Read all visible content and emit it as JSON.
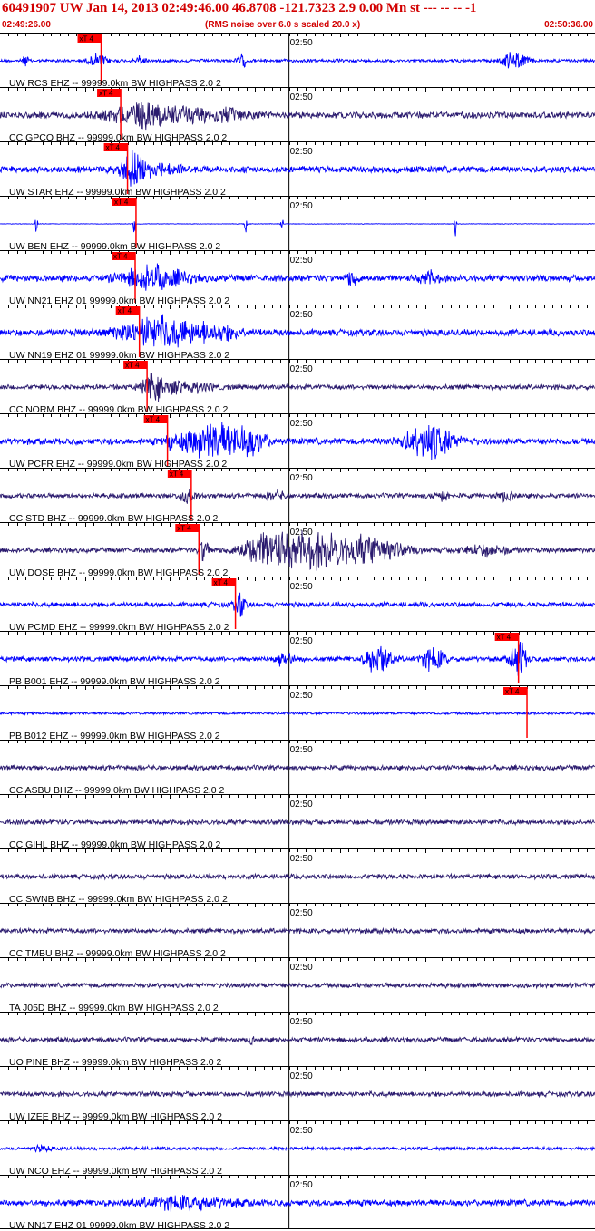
{
  "header": {
    "title": "60491907 UW Jan 14, 2013 02:49:46.00   46.8708 -121.7323  2.9 0.00 Mn st --- -- --  -1",
    "start_time": "02:49:26.00",
    "note": "(RMS noise over 6.0 s scaled 20.0 x)",
    "end_time": "02:50:36.00"
  },
  "colors": {
    "header_red": "#d20000",
    "trace_blue": "#0000ff",
    "trace_navy": "#2a1a6e",
    "pick_red": "#ff0000",
    "grid_black": "#000000"
  },
  "chart_data": {
    "type": "line",
    "chart": "seismogram record section",
    "x_start": "02:49:26.00",
    "x_end": "02:50:36.00",
    "time_marker_label": "02:50",
    "time_marker_seconds": 34,
    "total_seconds": 70,
    "pick_label": "xT 4",
    "traces": [
      {
        "label": "UW RCS EHZ -- 99999.0km BW  HIGHPASS  2.0  2",
        "color": "blue",
        "pick_s": 11.9,
        "amp": 2,
        "bursts": [
          [
            3.0,
            0.5,
            6
          ],
          [
            11.6,
            1.5,
            8
          ],
          [
            16.5,
            0.8,
            6
          ],
          [
            28.5,
            0.8,
            7
          ],
          [
            60.5,
            2.0,
            10
          ]
        ]
      },
      {
        "label": "CC GPCO BHZ -- 99999.0km BW  HIGHPASS  2.0  2",
        "color": "navy",
        "pick_s": 14.2,
        "amp": 4,
        "bursts": [
          [
            17.5,
            6.0,
            14
          ],
          [
            25.0,
            6.0,
            7
          ]
        ]
      },
      {
        "label": "UW STAR EHZ -- 99999.0km BW  HIGHPASS  2.0  2",
        "color": "blue",
        "pick_s": 15.0,
        "amp": 4,
        "bursts": [
          [
            15.3,
            1.5,
            20
          ],
          [
            18.0,
            4.0,
            8
          ]
        ]
      },
      {
        "label": "UW BEN EHZ -- 99999.0km BW  HIGHPASS  2.0  2",
        "color": "blue",
        "pick_s": 16.0,
        "amp": 0.4,
        "bursts": [
          [
            4.3,
            0.2,
            12
          ],
          [
            15.8,
            0.2,
            14
          ],
          [
            28.9,
            0.2,
            12
          ],
          [
            33.2,
            0.2,
            12
          ],
          [
            53.6,
            0.2,
            14
          ]
        ]
      },
      {
        "label": "UW NN21 EHZ 01 99999.0km BW  HIGHPASS  2.0  2",
        "color": "blue",
        "pick_s": 15.9,
        "amp": 4,
        "bursts": [
          [
            18.0,
            5.0,
            14
          ],
          [
            41.5,
            1.0,
            10
          ],
          [
            50.5,
            1.5,
            7
          ]
        ]
      },
      {
        "label": "UW NN19 EHZ 01 99999.0km BW  HIGHPASS  2.0  2",
        "color": "blue",
        "pick_s": 16.4,
        "amp": 4,
        "bursts": [
          [
            18.5,
            6.0,
            18
          ],
          [
            25.0,
            5.0,
            8
          ]
        ]
      },
      {
        "label": "CC NORM BHZ -- 99999.0km BW  HIGHPASS  2.0  2",
        "color": "navy",
        "pick_s": 17.3,
        "amp": 3,
        "bursts": [
          [
            18.0,
            1.5,
            13
          ],
          [
            21.0,
            5.0,
            7
          ]
        ]
      },
      {
        "label": "UW PCFR EHZ -- 99999.0km BW  HIGHPASS  2.0  2",
        "color": "blue",
        "pick_s": 19.7,
        "amp": 4,
        "bursts": [
          [
            20.0,
            0.5,
            12
          ],
          [
            25.0,
            5.0,
            22
          ],
          [
            29.5,
            2.5,
            12
          ],
          [
            50.5,
            4.0,
            20
          ]
        ]
      },
      {
        "label": "CC STD BHZ -- 99999.0km BW  HIGHPASS  2.0  2",
        "color": "navy",
        "pick_s": 22.5,
        "amp": 3,
        "bursts": [
          [
            22.0,
            1.5,
            7
          ],
          [
            32.5,
            1.5,
            5
          ],
          [
            52.0,
            1.5,
            5
          ],
          [
            59.5,
            1.5,
            5
          ]
        ]
      },
      {
        "label": "UW DOSE BHZ -- 99999.0km BW  HIGHPASS  2.0  2",
        "color": "navy",
        "pick_s": 23.4,
        "amp": 3,
        "bursts": [
          [
            24.0,
            0.8,
            15
          ],
          [
            31.0,
            4.0,
            18
          ],
          [
            37.0,
            6.0,
            22
          ],
          [
            44.0,
            5.0,
            15
          ],
          [
            57.0,
            4.0,
            6
          ]
        ]
      },
      {
        "label": "UW PCMD EHZ -- 99999.0km BW  HIGHPASS  2.0  2",
        "color": "blue",
        "pick_s": 27.7,
        "amp": 3,
        "bursts": [
          [
            28.2,
            0.8,
            15
          ]
        ]
      },
      {
        "label": "PB B001 EHZ -- 99999.0km BW  HIGHPASS  2.0  2",
        "color": "blue",
        "pick_s": 61.0,
        "amp": 3,
        "bursts": [
          [
            33.5,
            1.5,
            9
          ],
          [
            44.5,
            2.0,
            20
          ],
          [
            51.0,
            2.0,
            13
          ],
          [
            61.0,
            1.2,
            24
          ]
        ]
      },
      {
        "label": "PB B012 EHZ -- 99999.0km BW  HIGHPASS  2.0  2",
        "color": "blue",
        "pick_s": 62.0,
        "amp": 1.5,
        "bursts": []
      },
      {
        "label": "CC ASBU BHZ -- 99999.0km BW  HIGHPASS  2.0  2",
        "color": "navy",
        "pick_s": null,
        "amp": 3,
        "bursts": []
      },
      {
        "label": "CC GIHL BHZ -- 99999.0km BW  HIGHPASS  2.0  2",
        "color": "navy",
        "pick_s": null,
        "amp": 3,
        "bursts": []
      },
      {
        "label": "CC SWNB BHZ -- 99999.0km BW  HIGHPASS  2.0  2",
        "color": "navy",
        "pick_s": null,
        "amp": 3,
        "bursts": []
      },
      {
        "label": "CC TMBU BHZ -- 99999.0km BW  HIGHPASS  2.0  2",
        "color": "navy",
        "pick_s": null,
        "amp": 3,
        "bursts": []
      },
      {
        "label": "TA J05D BHZ -- 99999.0km BW  HIGHPASS  2.0  2",
        "color": "navy",
        "pick_s": null,
        "amp": 3,
        "bursts": []
      },
      {
        "label": "UO PINE BHZ -- 99999.0km BW  HIGHPASS  2.0  2",
        "color": "navy",
        "pick_s": null,
        "amp": 3,
        "bursts": [
          [
            29.5,
            0.4,
            6
          ]
        ]
      },
      {
        "label": "UW IZEE BHZ -- 99999.0km BW  HIGHPASS  2.0  2",
        "color": "navy",
        "pick_s": null,
        "amp": 3,
        "bursts": []
      },
      {
        "label": "UW NCO EHZ -- 99999.0km BW  HIGHPASS  2.0  2",
        "color": "blue",
        "pick_s": null,
        "amp": 2,
        "bursts": [
          [
            5.0,
            1.5,
            3
          ]
        ]
      },
      {
        "label": "UW NN17 EHZ 01 99999.0km BW  HIGHPASS  2.0  2",
        "color": "blue",
        "pick_s": null,
        "amp": 4,
        "bursts": [
          [
            22.0,
            7.0,
            7
          ]
        ]
      }
    ]
  }
}
